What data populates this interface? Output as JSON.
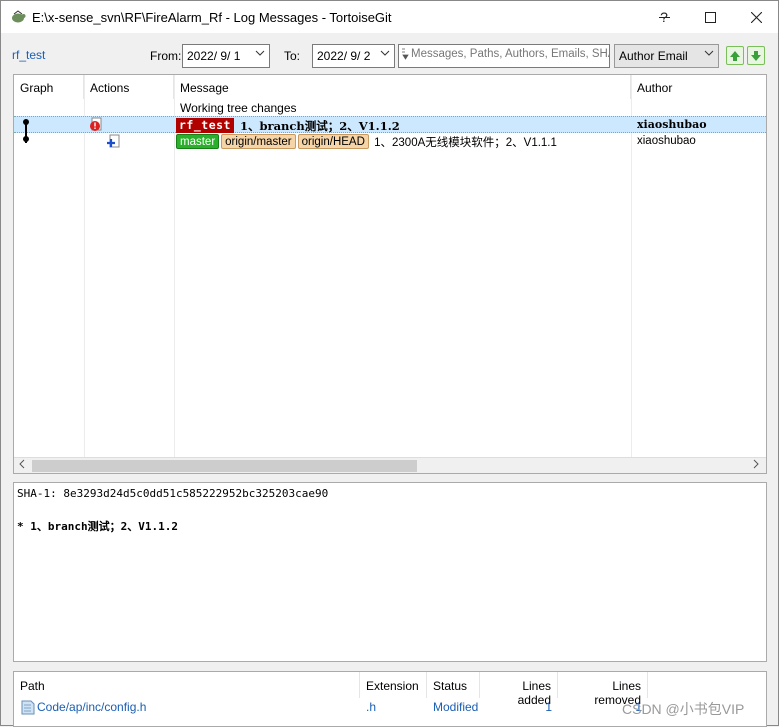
{
  "window": {
    "title": "E:\\x-sense_svn\\RF\\FireAlarm_Rf - Log Messages - TortoiseGit",
    "help": "?",
    "minimize": "—",
    "maximize": "☐",
    "close": "✕"
  },
  "toolbar": {
    "branch": "rf_test",
    "from_label": "From:",
    "from_date": "2022/ 9/ 1",
    "to_label": "To:",
    "to_date": "2022/ 9/ 2",
    "search_placeholder": "Messages, Paths, Authors, Emails, SHA-1",
    "filter_field": "Author Email"
  },
  "log": {
    "columns": [
      "Graph",
      "Actions",
      "Message",
      "Author"
    ],
    "working_tree": "Working tree changes",
    "rows": [
      {
        "refs": [
          {
            "label": "rf_test",
            "kind": "current"
          }
        ],
        "message": "1、branch测试；2、V1.1.2",
        "author": "xiaoshubao",
        "selected": true
      },
      {
        "refs": [
          {
            "label": "master",
            "kind": "local"
          },
          {
            "label": "origin/master",
            "kind": "remote"
          },
          {
            "label": "origin/HEAD",
            "kind": "remote"
          }
        ],
        "message": "1、2300A无线模块软件；2、V1.1.1",
        "author": "xiaoshubao",
        "selected": false
      }
    ]
  },
  "details": {
    "sha_line": "SHA-1: 8e3293d24d5c0dd51c585222952bc325203cae90",
    "body_line": "* 1、branch测试；2、V1.1.2"
  },
  "files": {
    "columns": [
      "Path",
      "Extension",
      "Status",
      "Lines added",
      "Lines removed"
    ],
    "rows": [
      {
        "path": "Code/ap/inc/config.h",
        "extension": ".h",
        "status": "Modified",
        "added": "1",
        "removed": "1"
      }
    ]
  },
  "watermark": "CSDN @小书包VIP",
  "colors": {
    "current_branch": "#b00000",
    "local_branch": "#2bb02b",
    "remote_branch": "#f5d5a8",
    "selection": "#cce8ff",
    "link": "#1a5fb4"
  }
}
